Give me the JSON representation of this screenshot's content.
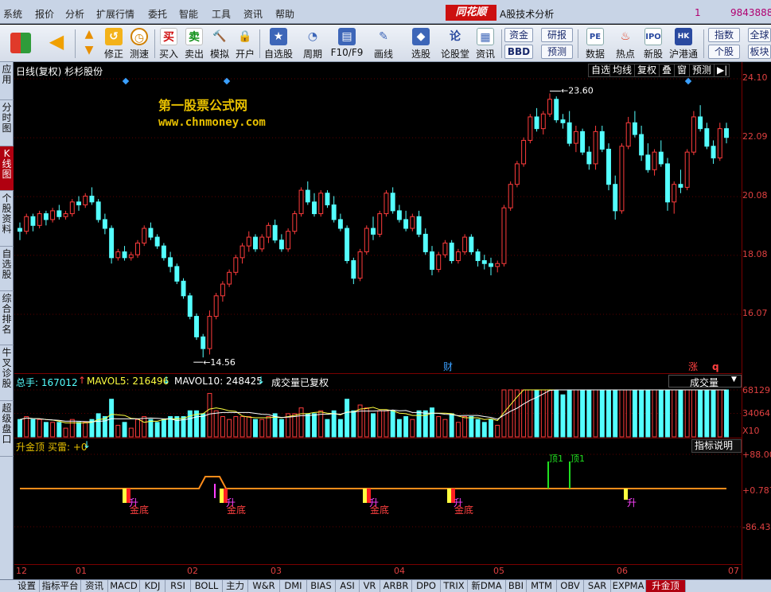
{
  "menu": {
    "items": [
      "系统",
      "报价",
      "分析",
      "扩展行情",
      "委托",
      "智能",
      "工具",
      "资讯",
      "帮助"
    ],
    "logo": "同花顺",
    "title": "A股技术分析",
    "num1": "1",
    "num2": "9843888831"
  },
  "toolbar": {
    "items": [
      "修正",
      "测速",
      "买入",
      "卖出",
      "模拟",
      "开户",
      "自选股",
      "周期",
      "F10/F9",
      "画线",
      "选股",
      "论股堂",
      "资讯",
      "数据",
      "热点",
      "新股",
      "沪港通"
    ],
    "boxes": [
      "资金",
      "研报",
      "BBD",
      "预测",
      "指数",
      "全球",
      "个股",
      "板块"
    ]
  },
  "left_tabs": [
    "应用",
    "分时图",
    "K线图",
    "个股资料",
    "自选股",
    "综合排名",
    "牛叉诊股",
    "超级盘口"
  ],
  "kline": {
    "header": "日线(复权)  杉杉股份",
    "buttons": [
      "自选",
      "均线",
      "复权",
      "叠",
      "窗",
      "预测"
    ],
    "watermark_title": "第一股票公式网",
    "watermark_url": "www.chnmoney.com",
    "high_label": "23.60",
    "low_label": "14.56",
    "marker_cai": "财",
    "marker_zhang": "涨",
    "marker_q": "q",
    "ticks": [
      "24.10",
      "22.09",
      "20.08",
      "18.08",
      "16.07"
    ],
    "ohlc": [
      [
        19.0,
        19.2,
        18.6,
        18.9
      ],
      [
        18.9,
        19.5,
        18.8,
        19.4
      ],
      [
        19.4,
        19.5,
        18.9,
        19.1
      ],
      [
        19.1,
        19.6,
        19.0,
        19.5
      ],
      [
        19.5,
        19.6,
        19.1,
        19.3
      ],
      [
        19.3,
        19.7,
        19.2,
        19.6
      ],
      [
        19.6,
        19.8,
        19.3,
        19.4
      ],
      [
        19.4,
        19.6,
        19.3,
        19.5
      ],
      [
        19.5,
        20.0,
        19.4,
        19.9
      ],
      [
        19.9,
        20.1,
        19.6,
        19.8
      ],
      [
        19.8,
        20.2,
        19.7,
        20.1
      ],
      [
        20.1,
        20.4,
        19.8,
        19.9
      ],
      [
        19.9,
        20.0,
        19.2,
        19.3
      ],
      [
        19.3,
        19.5,
        18.8,
        19.0
      ],
      [
        19.0,
        19.1,
        17.8,
        18.0
      ],
      [
        18.0,
        18.3,
        17.9,
        18.2
      ],
      [
        18.2,
        18.4,
        17.9,
        18.0
      ],
      [
        18.0,
        18.2,
        17.9,
        18.1
      ],
      [
        18.1,
        18.6,
        18.0,
        18.5
      ],
      [
        18.5,
        19.1,
        18.4,
        19.0
      ],
      [
        19.0,
        19.2,
        18.6,
        18.7
      ],
      [
        18.7,
        18.8,
        18.3,
        18.4
      ],
      [
        18.4,
        18.5,
        17.9,
        18.0
      ],
      [
        18.0,
        18.2,
        17.5,
        17.7
      ],
      [
        17.7,
        17.8,
        17.1,
        17.2
      ],
      [
        17.2,
        17.3,
        16.6,
        16.7
      ],
      [
        16.7,
        16.8,
        15.9,
        16.0
      ],
      [
        16.0,
        16.1,
        15.2,
        15.3
      ],
      [
        15.3,
        15.4,
        14.6,
        14.9
      ],
      [
        14.9,
        16.2,
        14.7,
        16.0
      ],
      [
        16.0,
        16.8,
        15.9,
        16.7
      ],
      [
        16.7,
        17.2,
        16.5,
        17.1
      ],
      [
        17.1,
        17.6,
        17.0,
        17.5
      ],
      [
        17.5,
        18.1,
        17.4,
        18.0
      ],
      [
        18.0,
        18.5,
        17.8,
        18.4
      ],
      [
        18.4,
        18.9,
        18.2,
        18.7
      ],
      [
        18.7,
        18.8,
        18.2,
        18.3
      ],
      [
        18.3,
        18.8,
        18.2,
        18.7
      ],
      [
        18.7,
        19.2,
        18.5,
        19.1
      ],
      [
        19.1,
        19.3,
        18.5,
        18.6
      ],
      [
        18.6,
        18.8,
        18.2,
        18.3
      ],
      [
        18.3,
        19.0,
        18.2,
        18.9
      ],
      [
        18.9,
        19.6,
        18.8,
        19.5
      ],
      [
        19.5,
        20.4,
        19.4,
        20.3
      ],
      [
        20.3,
        20.6,
        19.8,
        19.9
      ],
      [
        19.9,
        20.2,
        19.4,
        19.5
      ],
      [
        19.5,
        20.3,
        19.4,
        20.2
      ],
      [
        20.2,
        20.3,
        19.7,
        19.8
      ],
      [
        19.8,
        20.1,
        19.2,
        19.3
      ],
      [
        19.3,
        19.5,
        18.9,
        19.0
      ],
      [
        19.0,
        19.1,
        17.8,
        17.9
      ],
      [
        17.9,
        18.0,
        17.1,
        17.3
      ],
      [
        17.3,
        18.3,
        17.2,
        18.2
      ],
      [
        18.2,
        19.1,
        18.1,
        19.0
      ],
      [
        19.0,
        19.4,
        18.6,
        18.8
      ],
      [
        18.8,
        19.6,
        18.7,
        19.5
      ],
      [
        19.5,
        20.3,
        19.4,
        20.2
      ],
      [
        20.2,
        20.4,
        19.5,
        19.6
      ],
      [
        19.6,
        19.8,
        19.2,
        19.3
      ],
      [
        19.3,
        19.6,
        18.9,
        19.0
      ],
      [
        19.0,
        19.5,
        18.9,
        19.4
      ],
      [
        19.4,
        19.6,
        18.7,
        18.8
      ],
      [
        18.8,
        19.0,
        18.1,
        18.2
      ],
      [
        18.2,
        18.4,
        17.4,
        17.6
      ],
      [
        17.6,
        18.2,
        17.5,
        18.1
      ],
      [
        18.1,
        18.6,
        18.0,
        18.5
      ],
      [
        18.5,
        18.6,
        17.8,
        17.9
      ],
      [
        17.9,
        18.3,
        17.8,
        18.2
      ],
      [
        18.2,
        18.8,
        18.1,
        18.7
      ],
      [
        18.7,
        18.8,
        18.1,
        18.2
      ],
      [
        18.2,
        18.3,
        17.7,
        17.9
      ],
      [
        17.9,
        18.1,
        17.6,
        17.8
      ],
      [
        17.8,
        18.0,
        17.4,
        17.7
      ],
      [
        17.7,
        17.9,
        17.5,
        17.8
      ],
      [
        17.8,
        19.8,
        17.7,
        19.7
      ],
      [
        19.7,
        20.6,
        19.6,
        20.5
      ],
      [
        20.5,
        21.3,
        20.4,
        21.2
      ],
      [
        21.2,
        22.1,
        21.1,
        22.0
      ],
      [
        22.0,
        22.9,
        21.9,
        22.8
      ],
      [
        22.8,
        23.1,
        22.3,
        22.4
      ],
      [
        22.4,
        23.0,
        22.2,
        22.9
      ],
      [
        22.9,
        23.6,
        22.8,
        23.4
      ],
      [
        23.4,
        23.5,
        22.6,
        22.7
      ],
      [
        22.7,
        22.9,
        22.4,
        22.6
      ],
      [
        22.6,
        23.0,
        21.8,
        21.9
      ],
      [
        21.9,
        22.5,
        21.6,
        22.3
      ],
      [
        22.3,
        22.4,
        21.5,
        21.6
      ],
      [
        21.6,
        21.8,
        21.0,
        21.2
      ],
      [
        21.2,
        22.5,
        21.0,
        22.3
      ],
      [
        22.3,
        22.5,
        21.6,
        21.7
      ],
      [
        21.7,
        21.9,
        20.3,
        20.5
      ],
      [
        20.5,
        20.8,
        19.3,
        19.6
      ],
      [
        19.6,
        21.9,
        19.5,
        21.8
      ],
      [
        21.8,
        22.8,
        21.7,
        22.6
      ],
      [
        22.6,
        23.0,
        22.1,
        22.2
      ],
      [
        22.2,
        22.5,
        21.3,
        21.5
      ],
      [
        21.5,
        21.9,
        20.9,
        21.0
      ],
      [
        21.0,
        21.7,
        20.8,
        21.6
      ],
      [
        21.6,
        22.0,
        21.1,
        21.2
      ],
      [
        21.2,
        21.4,
        19.6,
        19.9
      ],
      [
        19.9,
        20.6,
        19.5,
        20.5
      ],
      [
        20.5,
        21.0,
        20.2,
        20.4
      ],
      [
        20.4,
        21.7,
        20.3,
        21.6
      ],
      [
        21.6,
        23.0,
        21.5,
        22.8
      ],
      [
        22.8,
        23.2,
        22.3,
        22.4
      ],
      [
        22.4,
        22.6,
        21.7,
        21.8
      ],
      [
        21.8,
        22.0,
        21.2,
        21.4
      ],
      [
        21.4,
        22.6,
        21.3,
        22.4
      ],
      [
        22.4,
        22.6,
        21.9,
        22.1
      ]
    ]
  },
  "volume": {
    "total_label": "总手: 167012",
    "mavol5_label": "MAVOL5: 216496",
    "mavol10_label": "MAVOL10: 248425",
    "note": "成交量已复权",
    "dropdown": "成交量",
    "ticks": [
      "68129",
      "34064",
      "X10"
    ]
  },
  "indicator": {
    "name": "升金顶",
    "sub": "买雷: +0",
    "explain_btn": "指标说明",
    "ticks": [
      "+88.00",
      "+0.787",
      "-86.43"
    ],
    "labels_jindi": "金底",
    "labels_sheng": "升",
    "labels_ding": "顶1"
  },
  "date_axis": [
    "12",
    "01",
    "02",
    "03",
    "04",
    "05",
    "06",
    "07"
  ],
  "bottom_tabs": [
    "设置",
    "指标平台",
    "资讯",
    "MACD",
    "KDJ",
    "RSI",
    "BOLL",
    "主力",
    "W&R",
    "DMI",
    "BIAS",
    "ASI",
    "VR",
    "ARBR",
    "DPO",
    "TRIX",
    "新DMA",
    "BBI",
    "MTM",
    "OBV",
    "SAR",
    "EXPMA",
    "升金顶"
  ],
  "colors": {
    "up": "#ff3c3c",
    "down": "#54ffff",
    "axis": "#7a0000",
    "accent": "#b00010"
  }
}
